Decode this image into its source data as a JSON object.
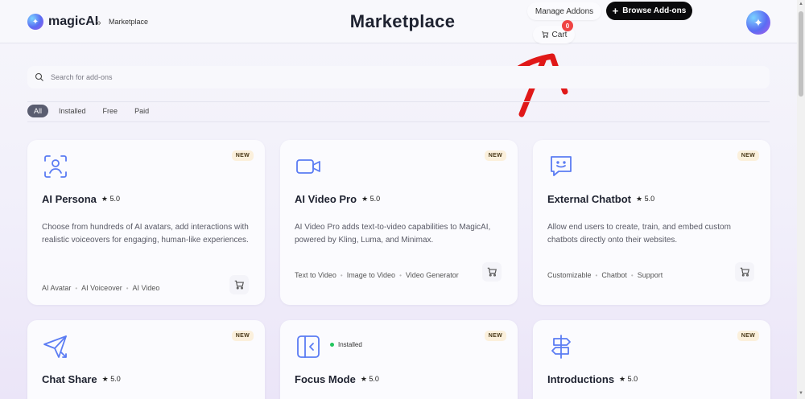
{
  "header": {
    "logo_text": "magicAI",
    "breadcrumb_sep": "»",
    "breadcrumb": "Marketplace",
    "title": "Marketplace",
    "manage_label": "Manage Addons",
    "browse_label": "Browse Add-ons",
    "cart_label": "Cart",
    "cart_count": "0"
  },
  "search": {
    "placeholder": "Search for add-ons"
  },
  "filters": [
    "All",
    "Installed",
    "Free",
    "Paid"
  ],
  "cards": [
    {
      "title": "AI Persona",
      "rating": "5.0",
      "badge": "NEW",
      "icon": "persona-icon",
      "description": "Choose from hundreds of AI avatars, add interactions with realistic voiceovers for engaging, human-like experiences.",
      "tags": [
        "AI Avatar",
        "AI Voiceover",
        "AI Video"
      ]
    },
    {
      "title": "AI Video Pro",
      "rating": "5.0",
      "badge": "NEW",
      "icon": "video-camera-icon",
      "description": "AI Video Pro adds text-to-video capabilities to MagicAI, powered by Kling, Luma, and Minimax.",
      "tags": [
        "Text to Video",
        "Image to Video",
        "Video Generator"
      ]
    },
    {
      "title": "External Chatbot",
      "rating": "5.0",
      "badge": "NEW",
      "icon": "chatbot-icon",
      "description": "Allow end users to create, train, and embed custom chatbots directly onto their websites.",
      "tags": [
        "Customizable",
        "Chatbot",
        "Support"
      ]
    },
    {
      "title": "Chat Share",
      "rating": "5.0",
      "badge": "NEW",
      "icon": "send-icon"
    },
    {
      "title": "Focus Mode",
      "rating": "5.0",
      "badge": "NEW",
      "icon": "sidebar-icon",
      "status": "Installed"
    },
    {
      "title": "Introductions",
      "rating": "5.0",
      "badge": "NEW",
      "icon": "signpost-icon"
    }
  ],
  "colors": {
    "accent": "#5b6cf3",
    "badge_bg": "#fbf0dc",
    "installed": "#22c55e",
    "annotation_arrow": "#e01818"
  }
}
